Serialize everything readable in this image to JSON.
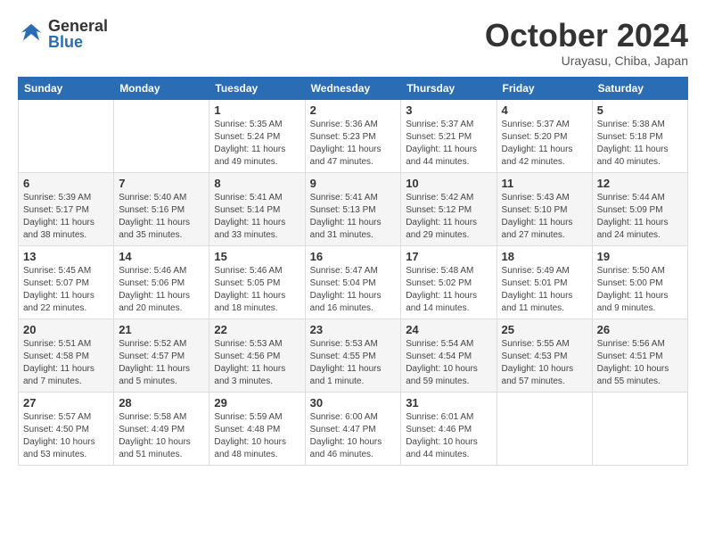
{
  "header": {
    "logo_general": "General",
    "logo_blue": "Blue",
    "month_title": "October 2024",
    "location": "Urayasu, Chiba, Japan"
  },
  "weekdays": [
    "Sunday",
    "Monday",
    "Tuesday",
    "Wednesday",
    "Thursday",
    "Friday",
    "Saturday"
  ],
  "weeks": [
    [
      null,
      null,
      {
        "day": "1",
        "sunrise": "5:35 AM",
        "sunset": "5:24 PM",
        "daylight": "11 hours and 49 minutes."
      },
      {
        "day": "2",
        "sunrise": "5:36 AM",
        "sunset": "5:23 PM",
        "daylight": "11 hours and 47 minutes."
      },
      {
        "day": "3",
        "sunrise": "5:37 AM",
        "sunset": "5:21 PM",
        "daylight": "11 hours and 44 minutes."
      },
      {
        "day": "4",
        "sunrise": "5:37 AM",
        "sunset": "5:20 PM",
        "daylight": "11 hours and 42 minutes."
      },
      {
        "day": "5",
        "sunrise": "5:38 AM",
        "sunset": "5:18 PM",
        "daylight": "11 hours and 40 minutes."
      }
    ],
    [
      {
        "day": "6",
        "sunrise": "5:39 AM",
        "sunset": "5:17 PM",
        "daylight": "11 hours and 38 minutes."
      },
      {
        "day": "7",
        "sunrise": "5:40 AM",
        "sunset": "5:16 PM",
        "daylight": "11 hours and 35 minutes."
      },
      {
        "day": "8",
        "sunrise": "5:41 AM",
        "sunset": "5:14 PM",
        "daylight": "11 hours and 33 minutes."
      },
      {
        "day": "9",
        "sunrise": "5:41 AM",
        "sunset": "5:13 PM",
        "daylight": "11 hours and 31 minutes."
      },
      {
        "day": "10",
        "sunrise": "5:42 AM",
        "sunset": "5:12 PM",
        "daylight": "11 hours and 29 minutes."
      },
      {
        "day": "11",
        "sunrise": "5:43 AM",
        "sunset": "5:10 PM",
        "daylight": "11 hours and 27 minutes."
      },
      {
        "day": "12",
        "sunrise": "5:44 AM",
        "sunset": "5:09 PM",
        "daylight": "11 hours and 24 minutes."
      }
    ],
    [
      {
        "day": "13",
        "sunrise": "5:45 AM",
        "sunset": "5:07 PM",
        "daylight": "11 hours and 22 minutes."
      },
      {
        "day": "14",
        "sunrise": "5:46 AM",
        "sunset": "5:06 PM",
        "daylight": "11 hours and 20 minutes."
      },
      {
        "day": "15",
        "sunrise": "5:46 AM",
        "sunset": "5:05 PM",
        "daylight": "11 hours and 18 minutes."
      },
      {
        "day": "16",
        "sunrise": "5:47 AM",
        "sunset": "5:04 PM",
        "daylight": "11 hours and 16 minutes."
      },
      {
        "day": "17",
        "sunrise": "5:48 AM",
        "sunset": "5:02 PM",
        "daylight": "11 hours and 14 minutes."
      },
      {
        "day": "18",
        "sunrise": "5:49 AM",
        "sunset": "5:01 PM",
        "daylight": "11 hours and 11 minutes."
      },
      {
        "day": "19",
        "sunrise": "5:50 AM",
        "sunset": "5:00 PM",
        "daylight": "11 hours and 9 minutes."
      }
    ],
    [
      {
        "day": "20",
        "sunrise": "5:51 AM",
        "sunset": "4:58 PM",
        "daylight": "11 hours and 7 minutes."
      },
      {
        "day": "21",
        "sunrise": "5:52 AM",
        "sunset": "4:57 PM",
        "daylight": "11 hours and 5 minutes."
      },
      {
        "day": "22",
        "sunrise": "5:53 AM",
        "sunset": "4:56 PM",
        "daylight": "11 hours and 3 minutes."
      },
      {
        "day": "23",
        "sunrise": "5:53 AM",
        "sunset": "4:55 PM",
        "daylight": "11 hours and 1 minute."
      },
      {
        "day": "24",
        "sunrise": "5:54 AM",
        "sunset": "4:54 PM",
        "daylight": "10 hours and 59 minutes."
      },
      {
        "day": "25",
        "sunrise": "5:55 AM",
        "sunset": "4:53 PM",
        "daylight": "10 hours and 57 minutes."
      },
      {
        "day": "26",
        "sunrise": "5:56 AM",
        "sunset": "4:51 PM",
        "daylight": "10 hours and 55 minutes."
      }
    ],
    [
      {
        "day": "27",
        "sunrise": "5:57 AM",
        "sunset": "4:50 PM",
        "daylight": "10 hours and 53 minutes."
      },
      {
        "day": "28",
        "sunrise": "5:58 AM",
        "sunset": "4:49 PM",
        "daylight": "10 hours and 51 minutes."
      },
      {
        "day": "29",
        "sunrise": "5:59 AM",
        "sunset": "4:48 PM",
        "daylight": "10 hours and 48 minutes."
      },
      {
        "day": "30",
        "sunrise": "6:00 AM",
        "sunset": "4:47 PM",
        "daylight": "10 hours and 46 minutes."
      },
      {
        "day": "31",
        "sunrise": "6:01 AM",
        "sunset": "4:46 PM",
        "daylight": "10 hours and 44 minutes."
      },
      null,
      null
    ]
  ]
}
